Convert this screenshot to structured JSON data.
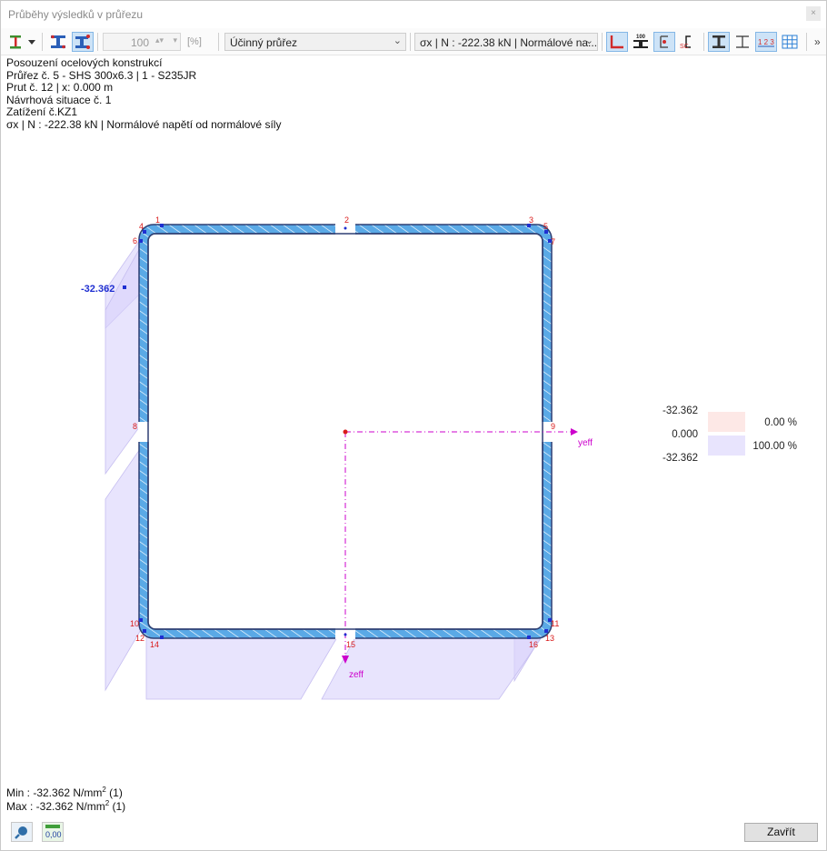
{
  "window": {
    "title": "Průběhy výsledků v průřezu",
    "close_glyph": "×"
  },
  "toolbar": {
    "scale_value": "100",
    "scale_unit": "[%]",
    "section_combo": "Účinný průřez",
    "result_combo": "σx | N : -222.38 kN | Normálové na...",
    "more": "»",
    "icons": [
      "section-type-icon",
      "stress-points-icon",
      "stress-points-numbered-icon",
      "axes-icon",
      "dimension-icon",
      "shear-center-icon",
      "section-view-icon",
      "outline-icon",
      "numbering-icon",
      "grid-icon"
    ]
  },
  "info": {
    "line1": "Posouzení ocelových konstrukcí",
    "line2": "Průřez č. 5 - SHS 300x6.3 | 1 - S235JR",
    "line3": "Prut č. 12 | x: 0.000 m",
    "line4": "Návrhová situace č. 1",
    "line5": "Zatížení č.KZ1",
    "line6": "σx | N : -222.38 kN | Normálové napětí od normálové síly"
  },
  "diagram": {
    "value_label": "-32.362",
    "axis_y": "yeff",
    "axis_z": "zeff",
    "points": [
      "1",
      "2",
      "3",
      "4",
      "5",
      "6",
      "7",
      "8",
      "9",
      "10",
      "11",
      "12",
      "13",
      "14",
      "15",
      "16"
    ],
    "colors": {
      "profile": "#5aa9e6",
      "stress": "#d9d2fb",
      "outline": "#2e3f73",
      "points": "#1f2fd1",
      "labels": "#d91a1a",
      "axes": "#cc00cc"
    }
  },
  "legend": {
    "values": [
      "-32.362",
      "0.000",
      "-32.362"
    ],
    "rows": [
      {
        "percent": "0.00 %",
        "color": "#fde8e6"
      },
      {
        "percent": "100.00 %",
        "color": "#e8e4fd"
      }
    ]
  },
  "summary": {
    "min": "Min : -32.362 N/mm",
    "min_ref": " (1)",
    "max": "Max : -32.362 N/mm",
    "max_ref": " (1)",
    "exp": "2"
  },
  "buttons": {
    "close": "Zavřít",
    "bottom_icons": [
      "search-icon",
      "decimal-places-icon"
    ]
  }
}
